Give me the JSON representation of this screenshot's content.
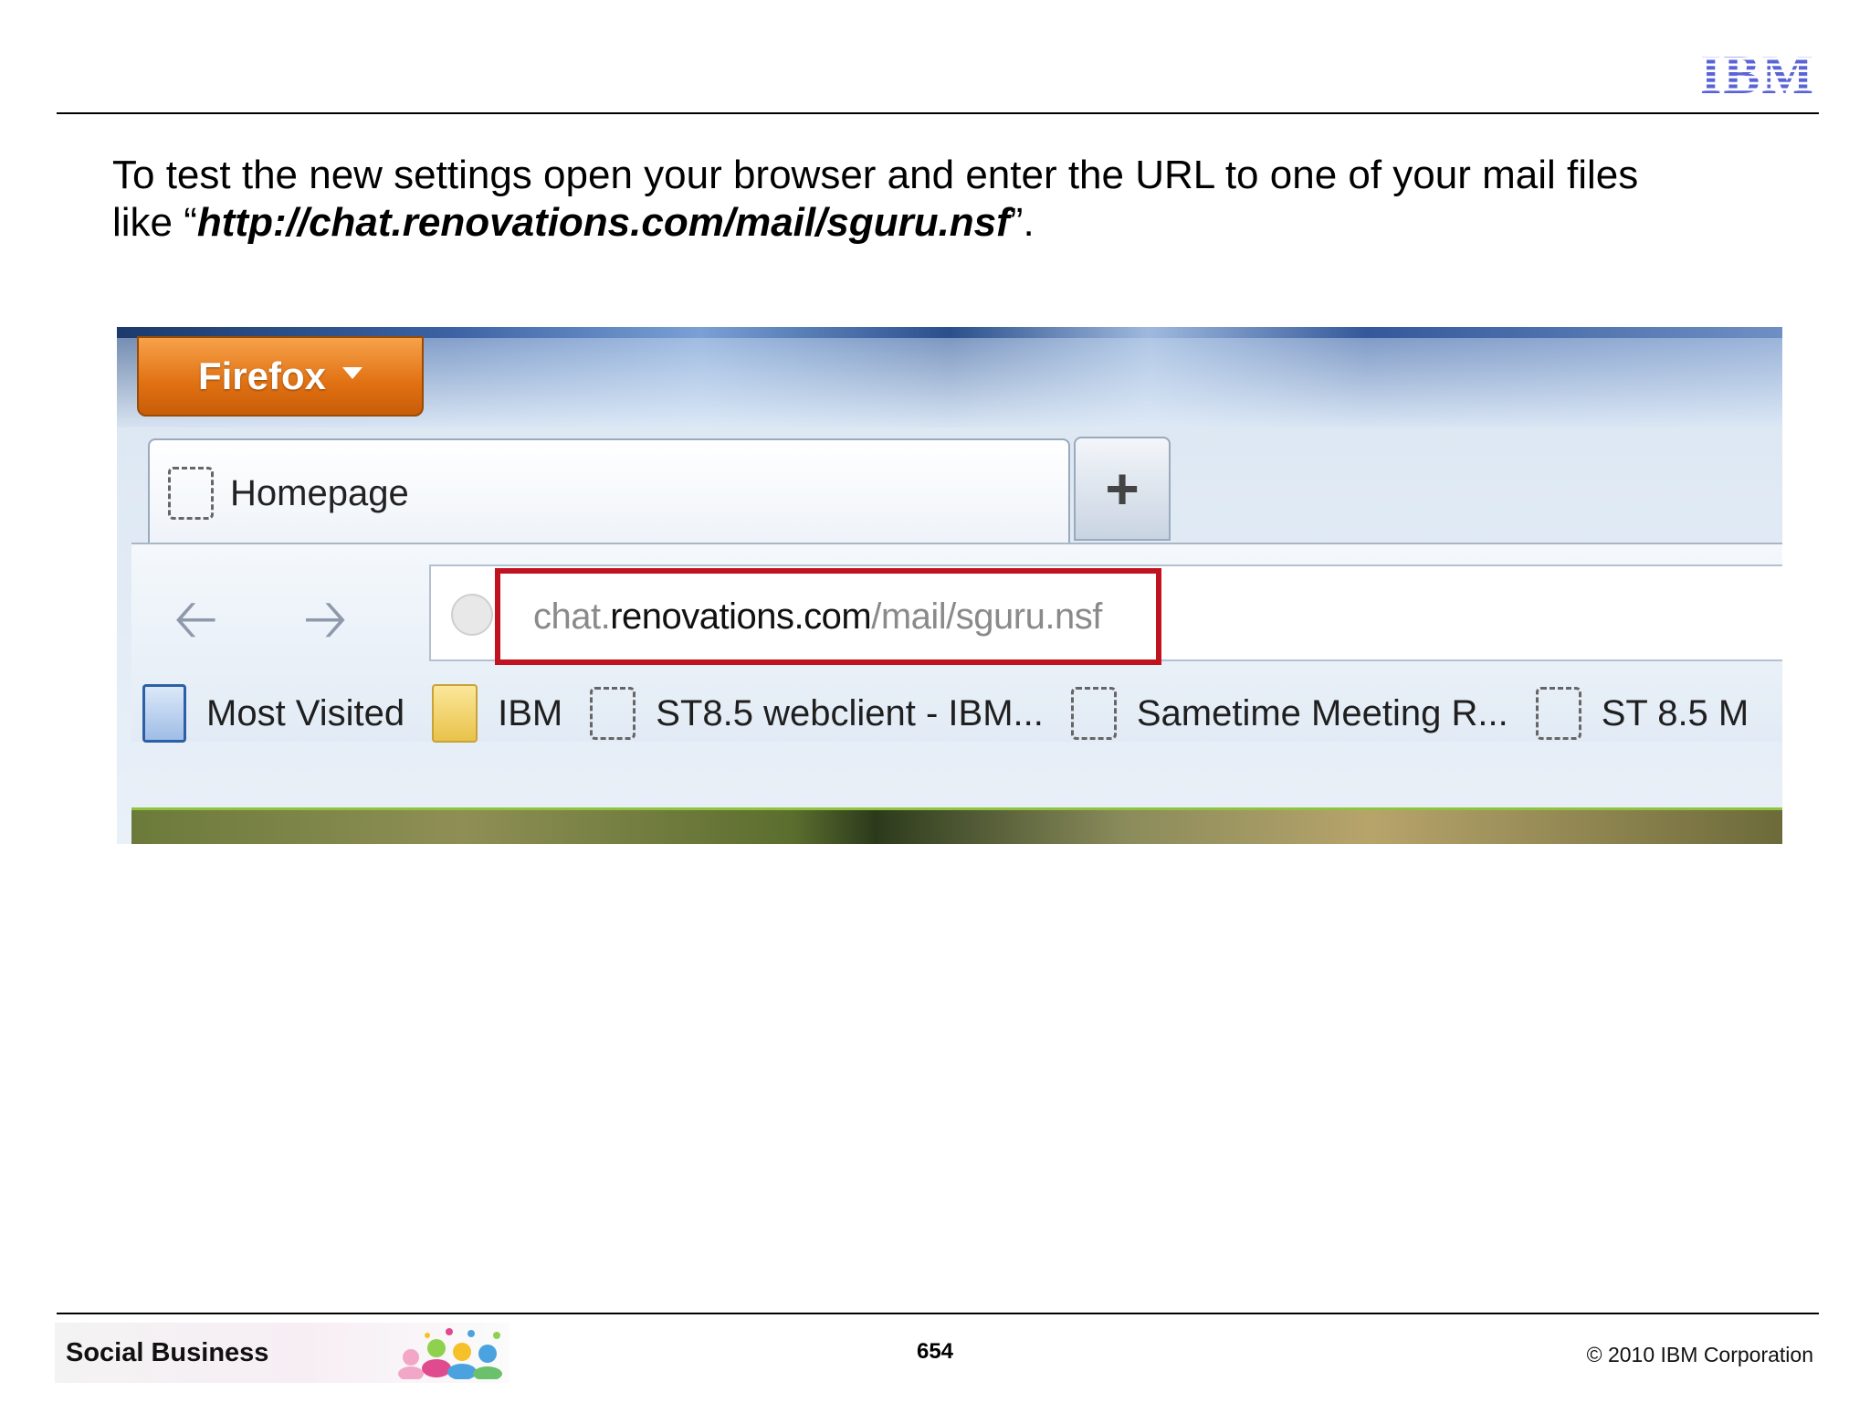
{
  "header": {
    "logo_text": "IBM"
  },
  "body": {
    "text_line1": "To test the new settings open your browser and enter the URL to one of your mail files",
    "text_line2_prefix": "like “",
    "text_line2_url": "http://chat.renovations.com/mail/sguru.nsf",
    "text_line2_suffix": "”."
  },
  "browser": {
    "menu_button_label": "Firefox",
    "tab_label": "Homepage",
    "new_tab_label": "+",
    "url_part1": "chat.",
    "url_part2": "renovations.com",
    "url_part3": "/mail/sguru.nsf",
    "bookmarks": [
      {
        "label": "Most Visited",
        "icon": "most-visited-icon"
      },
      {
        "label": "IBM",
        "icon": "folder-icon"
      },
      {
        "label": "ST8.5 webclient - IBM...",
        "icon": "page-icon"
      },
      {
        "label": "Sametime Meeting R...",
        "icon": "page-icon"
      },
      {
        "label": "ST 8.5 M",
        "icon": "page-icon"
      }
    ],
    "highlight_color": "#c1121f",
    "menu_button_color": "#e07012"
  },
  "footer": {
    "left_label": "Social Business",
    "page_number": "654",
    "copyright": "© 2010 IBM Corporation"
  }
}
